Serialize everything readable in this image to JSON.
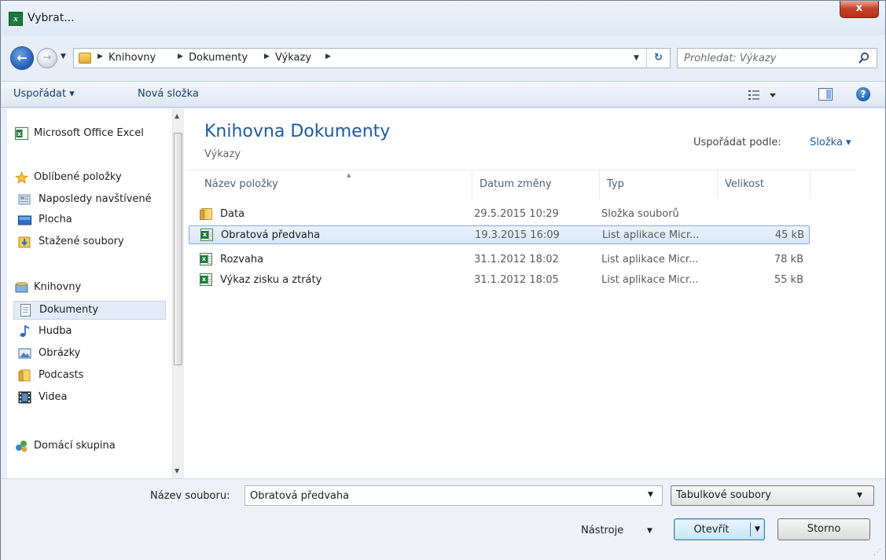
{
  "window": {
    "title": "Vybrat...",
    "close_label": "x"
  },
  "address_bar": {
    "breadcrumbs": [
      "Knihovny",
      "Dokumenty",
      "Výkazy"
    ],
    "search_placeholder": "Prohledat: Výkazy"
  },
  "toolbar": {
    "organize_label": "Uspořádat ▾",
    "new_folder_label": "Nová složka"
  },
  "navigation": {
    "items": [
      {
        "label": "Microsoft Office Excel",
        "icon": "excel-icon"
      },
      {
        "label": "Oblíbené položky",
        "icon": "star-icon"
      },
      {
        "label": "Naposledy navštívené",
        "icon": "recent-places-icon"
      },
      {
        "label": "Plocha",
        "icon": "desktop-icon"
      },
      {
        "label": "Stažené soubory",
        "icon": "downloads-folder-icon"
      },
      {
        "label": "Knihovny",
        "icon": "libraries-icon"
      },
      {
        "label": "Dokumenty",
        "icon": "documents-icon"
      },
      {
        "label": "Hudba",
        "icon": "music-icon"
      },
      {
        "label": "Obrázky",
        "icon": "pictures-icon"
      },
      {
        "label": "Podcasts",
        "icon": "folder-icon"
      },
      {
        "label": "Videa",
        "icon": "videos-icon"
      },
      {
        "label": "Domácí skupina",
        "icon": "homegroup-icon"
      }
    ],
    "selected": "Dokumenty"
  },
  "library": {
    "title": "Knihovna Dokumenty",
    "subtitle": "Výkazy",
    "arrange_label": "Uspořádat podle:",
    "arrange_value": "Složka ▾"
  },
  "file_list": {
    "columns": [
      "Název položky",
      "Datum změny",
      "Typ",
      "Velikost"
    ],
    "rows": [
      {
        "name": "Data",
        "date": "29.5.2015 10:29",
        "type": "Složka souborů",
        "size": "",
        "icon": "folder-icon"
      },
      {
        "name": "Obratová předvaha",
        "date": "19.3.2015 16:09",
        "type": "List aplikace Micr...",
        "size": "45 kB",
        "icon": "excel-file-icon"
      },
      {
        "name": "Rozvaha",
        "date": "31.1.2012 18:02",
        "type": "List aplikace Micr...",
        "size": "78 kB",
        "icon": "excel-file-icon"
      },
      {
        "name": "Výkaz zisku a ztráty",
        "date": "31.1.2012 18:05",
        "type": "List aplikace Micr...",
        "size": "55 kB",
        "icon": "excel-file-icon"
      }
    ],
    "selected_index": 1
  },
  "footer": {
    "filename_label": "Název souboru:",
    "filename_value": "Obratová předvaha",
    "filetype_value": "Tabulkové soubory",
    "tools_label": "Nástroje",
    "open_label": "Otevřít",
    "cancel_label": "Storno"
  },
  "colors": {
    "accent": "#1e5a9b",
    "selection": "#d6e6fb",
    "excel_green": "#1d7a3c"
  }
}
